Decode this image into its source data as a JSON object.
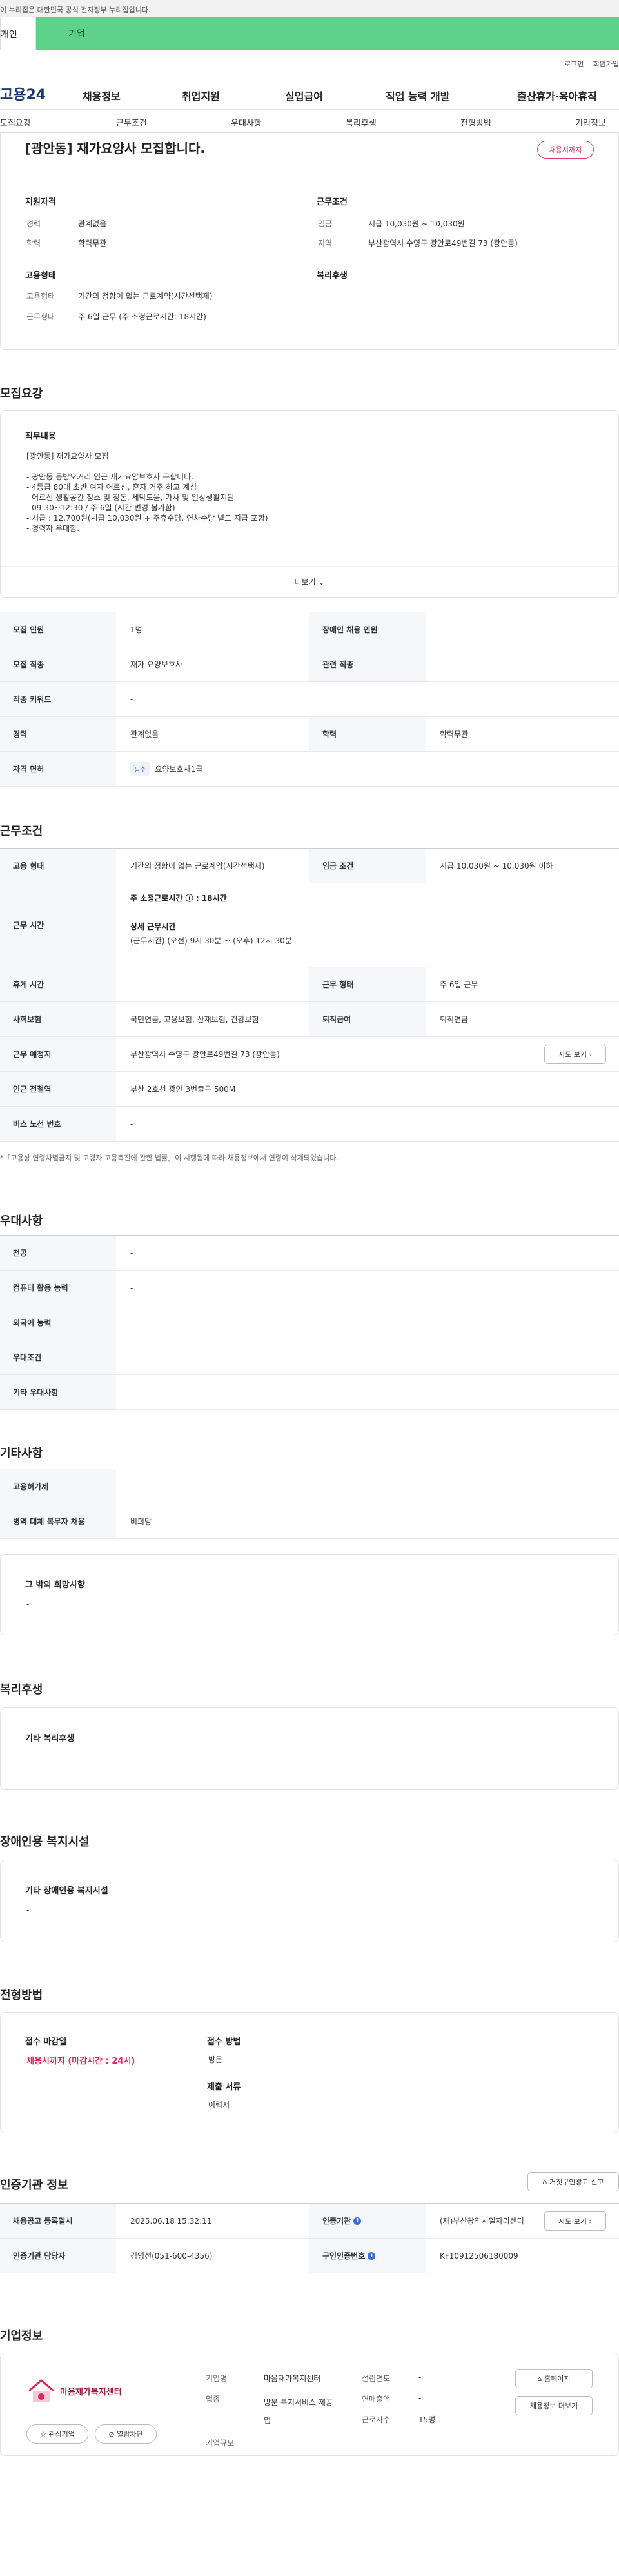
{
  "banner": {
    "text": "이 누리집은 대한민국 공식 전자정부 누리집입니다."
  },
  "tabs": {
    "individual": "개인",
    "corporate": "기업"
  },
  "util": {
    "login": "로그인",
    "join": "회원가입"
  },
  "site": {
    "logo": "고용24"
  },
  "nav": [
    "채용정보",
    "취업지원",
    "실업급여",
    "직업 능력 개발",
    "출산휴가·육아휴직"
  ],
  "subnav": [
    "모집요강",
    "근무조건",
    "우대사항",
    "복리후생",
    "전형방법",
    "기업정보"
  ],
  "job": {
    "title": "[광안동] 재가요양사 모집합니다.",
    "status": "채용시까지",
    "qual_head": "지원자격",
    "cond_head": "근무조건",
    "exp_label": "경력",
    "exp_value": "관계없음",
    "edu_label": "학력",
    "edu_value": "학력무관",
    "wage_label": "임금",
    "wage_value": "시급 10,030원 ~ 10,030원",
    "area_label": "지역",
    "area_value": "부산광역시 수영구 광안로49번길 73 (광안동)",
    "emp_head": "고용형태",
    "welfare_head": "복리후생",
    "emp_label": "고용형태",
    "emp_value": "기간의 정함이 없는 근로계약(시간선택제)",
    "worktype_label": "근무형태",
    "worktype_value": "주 6일 근무 (주 소정근로시간: 18시간)"
  },
  "recruit": {
    "title": "모집요강",
    "duty_head": "직무내용",
    "duty_lines": [
      "[광안동] 재가요양사 모집",
      "",
      "- 광안동 동방오거리 인근 재가요양보호사 구합니다.",
      "- 4등급 80대 초반 여자 어르신, 혼자 거주 하고 계심",
      "- 어르신 생활공간 청소 및 정돈, 세탁도움, 가사 및 일상생활지원",
      "- 09:30~12:30 / 주 6일 (시간 변경 불가함)",
      "- 시급 : 12,700원(시급 10,030원 + 주휴수당, 연차수당 별도 지급 포함)",
      "- 경력자 우대함."
    ],
    "more": "더보기",
    "rows": [
      {
        "l1": "모집 인원",
        "v1": "1명",
        "l2": "장애인 채용 인원",
        "v2": "-"
      },
      {
        "l1": "모집 직종",
        "v1": "재가 요양보호사",
        "l2": "관련 직종",
        "v2": "-"
      },
      {
        "l1": "직종 키워드",
        "v1": "-"
      },
      {
        "l1": "경력",
        "v1": "관계없음",
        "l2": "학력",
        "v2": "학력무관"
      },
      {
        "l1": "자격 면허",
        "badge": "필수",
        "v1": "요양보호사1급"
      }
    ]
  },
  "cond": {
    "title": "근무조건",
    "emp_label": "고용 형태",
    "emp_value": "기간의 정함이 없는 근로계약(시간선택제)",
    "wage_label": "임금 조건",
    "wage_value": "시급 10,030원 ~ 10,030원 이하",
    "hours_label": "근무 시간",
    "hours_weekly": "주 소정근로시간 ⓘ : 18시간",
    "hours_detail_head": "상세 근무시간",
    "hours_detail": "(근무시간) (오전) 9시 30분 ~ (오후) 12시 30분",
    "rest_label": "휴게 시간",
    "rest_value": "-",
    "worktype_label": "근무 형태",
    "worktype_value": "주 6일 근무",
    "insurance_label": "사회보험",
    "insurance_value": "국민연금, 고용보험, 산재보험, 건강보험",
    "retire_label": "퇴직급여",
    "retire_value": "퇴직연금",
    "place_label": "근무 예정지",
    "place_value": "부산광역시 수영구 광안로49번길 73 (광안동)",
    "map_btn": "지도 보기",
    "subway_label": "인근 전철역",
    "subway_value": "부산 2호선 광안 3번출구 500M",
    "bus_label": "버스 노선 번호",
    "bus_value": "-",
    "note": "*「고용상 연령차별금지 및 고령자 고용촉진에 관한 법률」이 시행됨에 따라 채용정보에서 연령이 삭제되었습니다."
  },
  "pref": {
    "title": "우대사항",
    "rows": [
      {
        "l": "전공",
        "v": "-"
      },
      {
        "l": "컴퓨터 활용 능력",
        "v": "-"
      },
      {
        "l": "외국어 능력",
        "v": "-"
      },
      {
        "l": "우대조건",
        "v": "-"
      },
      {
        "l": "기타 우대사항",
        "v": "-"
      }
    ]
  },
  "etc": {
    "title": "기타사항",
    "rows": [
      {
        "l": "고용허가제",
        "v": "-"
      },
      {
        "l": "병역 대체 복무자 채용",
        "v": "비희망"
      }
    ],
    "other_head": "그 밖의 희망사항",
    "other_value": "-"
  },
  "welfare": {
    "title": "복리후생",
    "head": "기타 복리후생",
    "value": "-"
  },
  "disabled": {
    "title": "장애인용 복지시설",
    "head": "기타 장애인용 복지시설",
    "value": "-"
  },
  "screening": {
    "title": "전형방법",
    "deadline_head": "접수 마감일",
    "deadline_value": "채용시까지 (마감시간 : 24시)",
    "method_head": "접수 방법",
    "method_value": "방문",
    "docs_head": "제출 서류",
    "docs_value": "이력서"
  },
  "cert": {
    "title": "인증기관 정보",
    "report_btn": "거짓구인광고 신고",
    "reg_label": "채용공고 등록일시",
    "reg_value": "2025.06.18 15:32:11",
    "org_label": "인증기관",
    "org_value": "(재)부산광역시일자리센터",
    "manager_label": "인증기관 담당자",
    "manager_value": "김영선(051-600-4356)",
    "num_label": "구인인증번호",
    "num_value": "KF10912506180009",
    "map_btn": "지도 보기"
  },
  "company": {
    "title": "기업정보",
    "logo_text": "마음재가복지센터",
    "fav_btn": "관심기업",
    "block_btn": "열람차단",
    "name_label": "기업명",
    "name_value": "마음재가복지센터",
    "industry_label": "업종",
    "industry_value": "방문 복지서비스 제공업",
    "size_label": "기업규모",
    "size_value": "-",
    "year_label": "설립연도",
    "year_value": "-",
    "sales_label": "연매출액",
    "sales_value": "-",
    "staff_label": "근로자수",
    "staff_value": "15명",
    "homepage_btn": "홈페이지",
    "jobs_btn": "채용정보 더보기"
  }
}
